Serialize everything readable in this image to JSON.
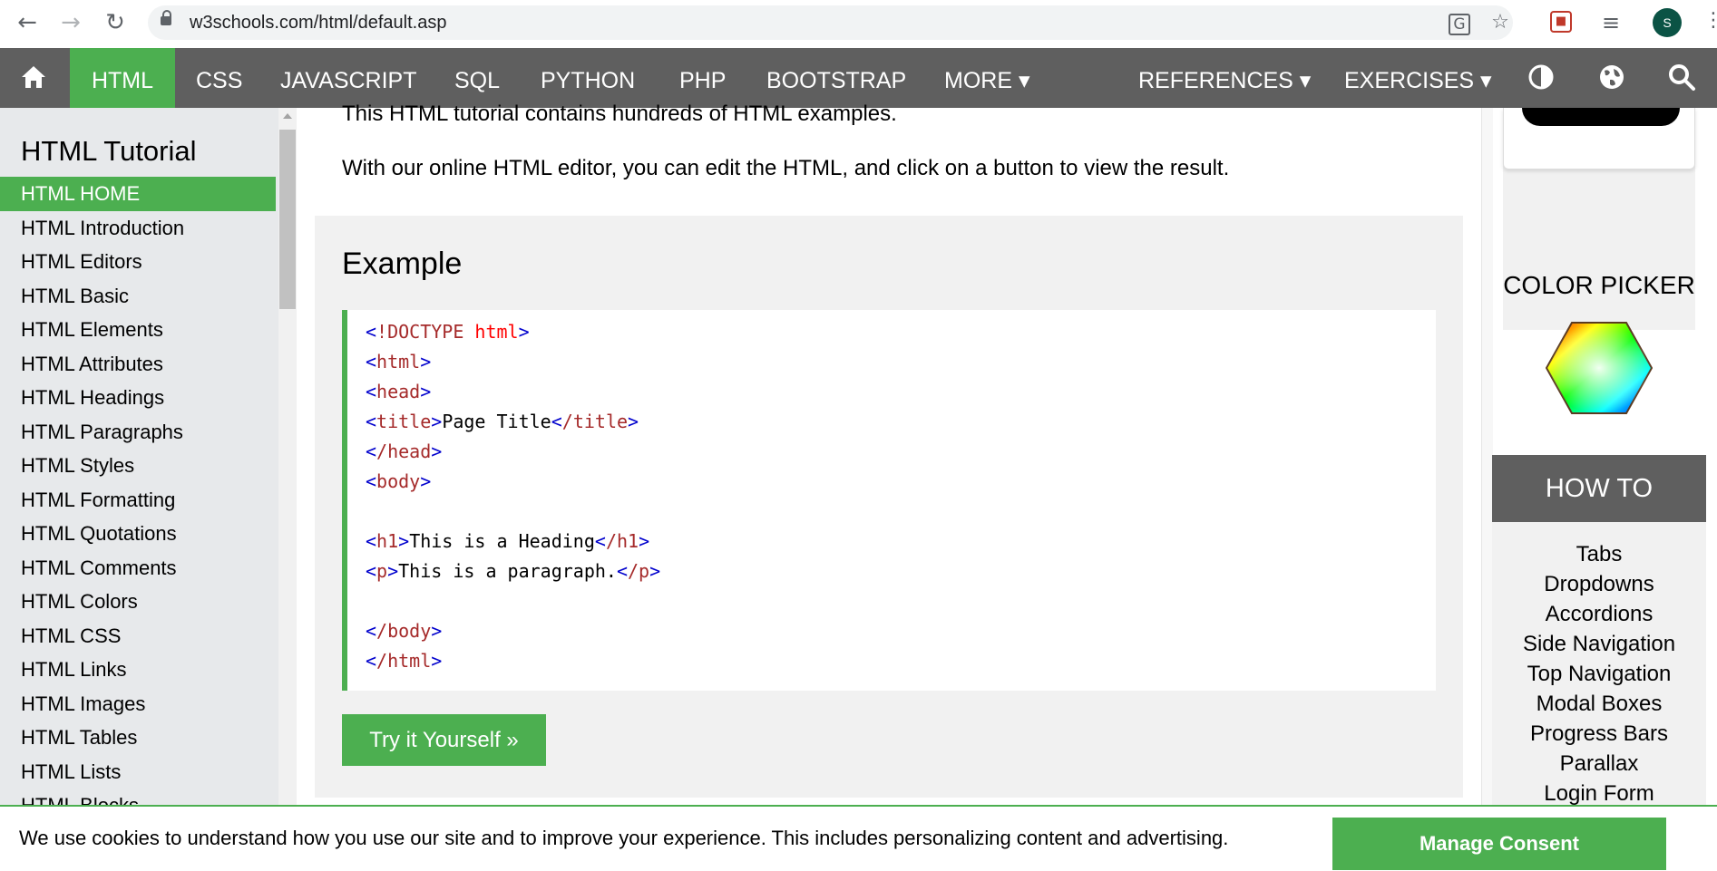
{
  "browser": {
    "url": "w3schools.com/html/default.asp",
    "avatar_letter": "S"
  },
  "topnav": {
    "items": [
      "HTML",
      "CSS",
      "JAVASCRIPT",
      "SQL",
      "PYTHON",
      "PHP",
      "BOOTSTRAP",
      "MORE ▾",
      "REFERENCES ▾",
      "EXERCISES ▾"
    ],
    "active": "HTML",
    "accent": "#4caf50",
    "bg": "#5f5f5f"
  },
  "sidebar": {
    "title": "HTML Tutorial",
    "items": [
      "HTML HOME",
      "HTML Introduction",
      "HTML Editors",
      "HTML Basic",
      "HTML Elements",
      "HTML Attributes",
      "HTML Headings",
      "HTML Paragraphs",
      "HTML Styles",
      "HTML Formatting",
      "HTML Quotations",
      "HTML Comments",
      "HTML Colors",
      "HTML CSS",
      "HTML Links",
      "HTML Images",
      "HTML Tables",
      "HTML Lists",
      "HTML Blocks"
    ],
    "active": "HTML HOME"
  },
  "main": {
    "intro_line": "This HTML tutorial contains hundreds of HTML examples.",
    "editor_line": "With our online HTML editor, you can edit the HTML, and click on a button to view the result.",
    "example_title": "Example",
    "code": {
      "l1": [
        "<!DOCTYPE html>"
      ],
      "l2": "<html>",
      "l3": "<head>",
      "l4_open": "<title>",
      "l4_text": "Page Title",
      "l4_close": "</title>",
      "l5": "</head>",
      "l6": "<body>",
      "l7_open": "<h1>",
      "l7_text": "This is a Heading",
      "l7_close": "</h1>",
      "l8_open": "<p>",
      "l8_text": "This is a paragraph.",
      "l8_close": "</p>",
      "l9": "</body>",
      "l10": "</html>"
    },
    "try_button": "Try it Yourself »"
  },
  "right": {
    "color_picker_title": "COLOR PICKER",
    "howto_title": "HOW TO",
    "howto_items": [
      "Tabs",
      "Dropdowns",
      "Accordions",
      "Side Navigation",
      "Top Navigation",
      "Modal Boxes",
      "Progress Bars",
      "Parallax",
      "Login Form"
    ]
  },
  "cookie": {
    "text": "We use cookies to understand how you use our site and to improve your experience. This includes personalizing content and advertising.",
    "button": "Manage Consent"
  }
}
